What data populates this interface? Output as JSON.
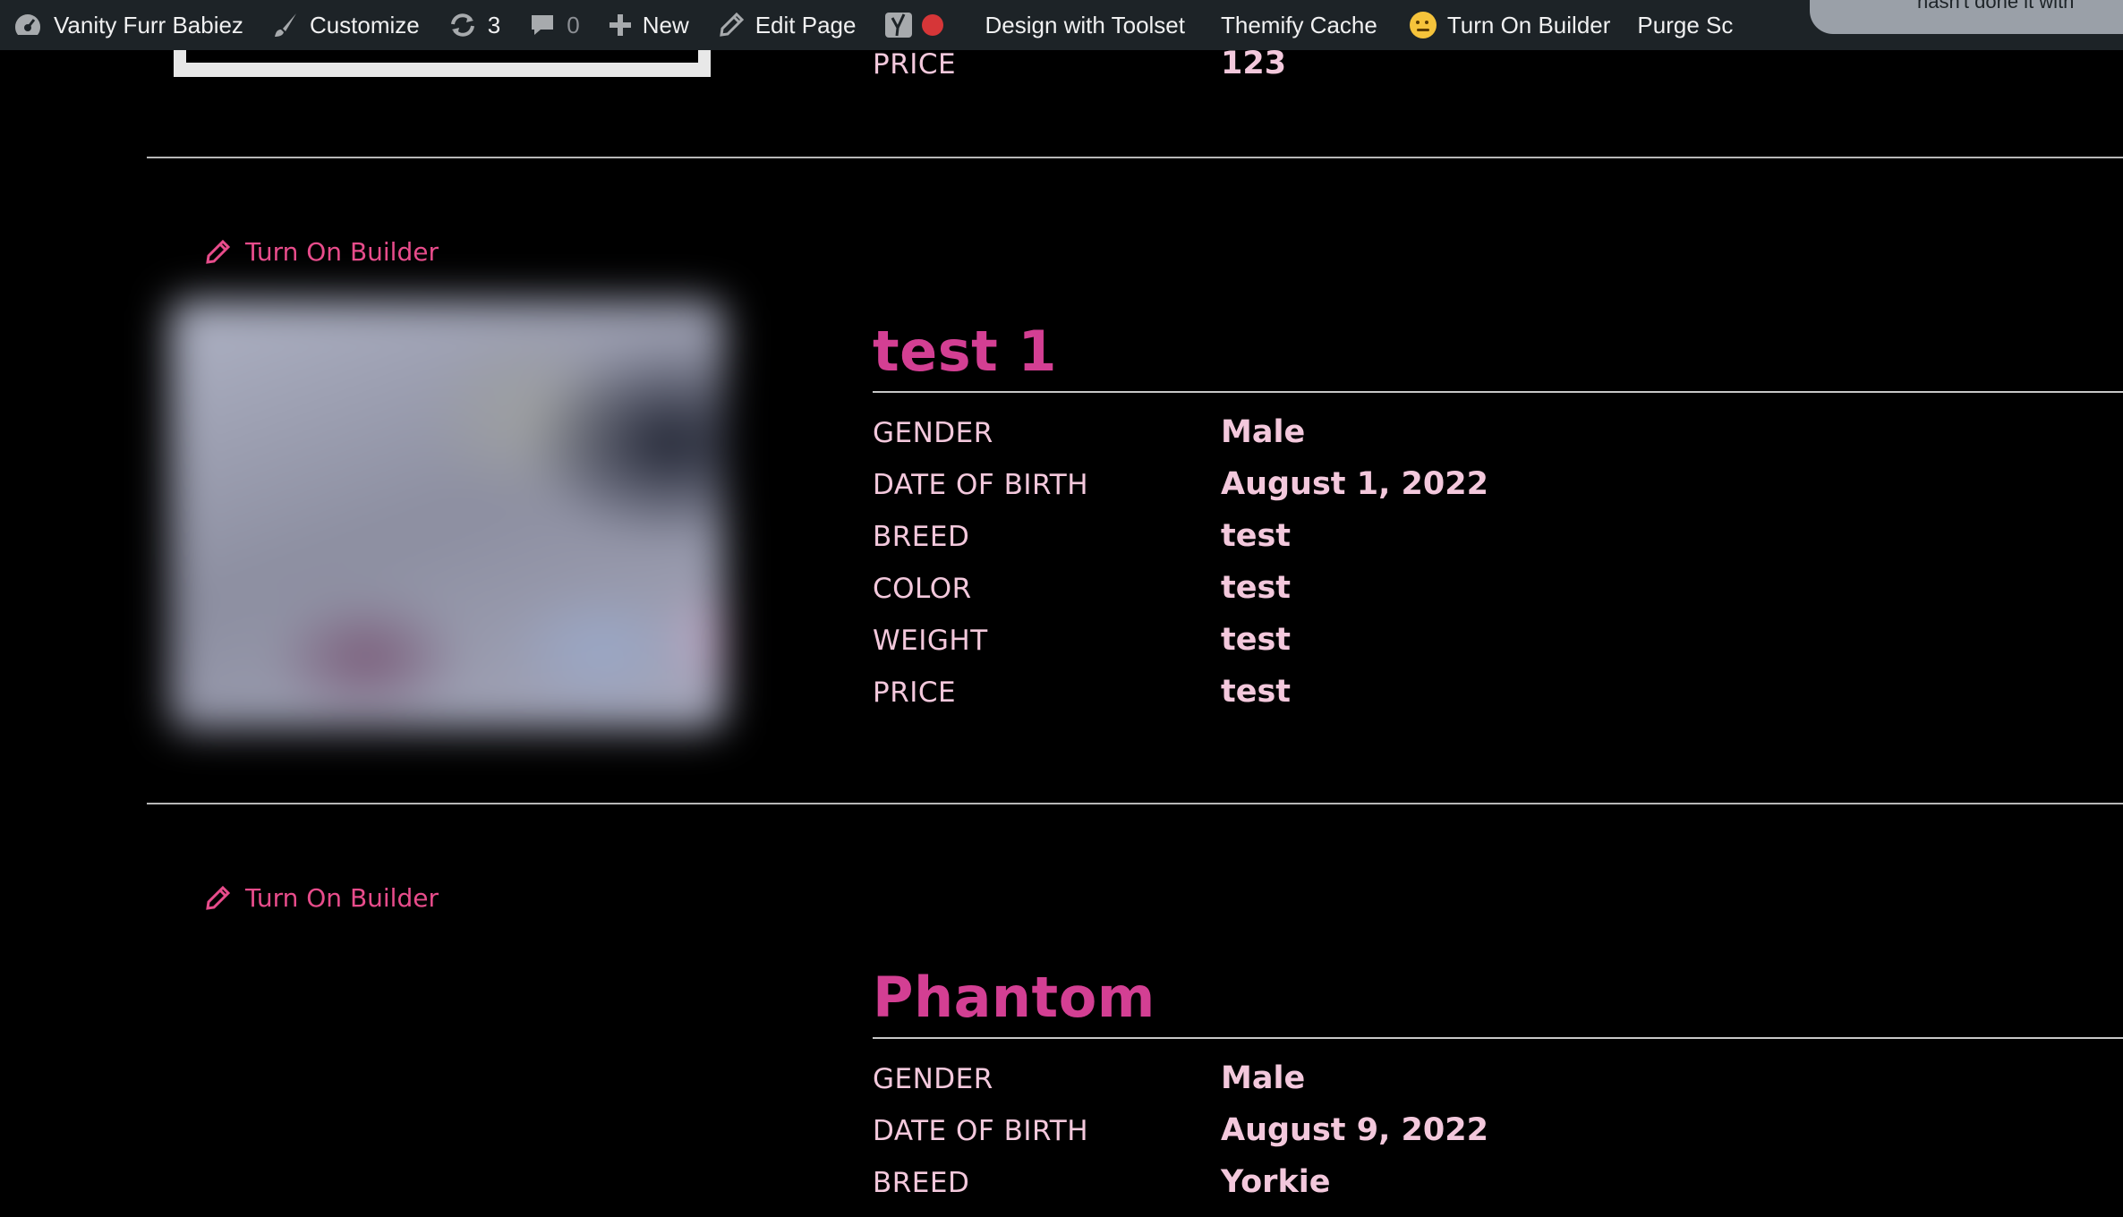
{
  "adminbar": {
    "site_name": "Vanity Furr Babiez",
    "customize": "Customize",
    "updates_count": "3",
    "comments_count": "0",
    "new": "New",
    "edit_page": "Edit Page",
    "design_toolset": "Design with Toolset",
    "themify_cache": "Themify Cache",
    "turn_on_builder": "Turn On Builder",
    "purge": "Purge Sc"
  },
  "notice_fragment": "hasn't done it with",
  "colors": {
    "accent": "#d33f93",
    "link": "#e84c8b",
    "text": "#f3c8dc",
    "adminbar": "#1d2327"
  },
  "entries": [
    {
      "fields": [
        {
          "label": "PRICE",
          "value": "123"
        }
      ]
    },
    {
      "builder_link": "Turn On Builder",
      "title": "test 1",
      "fields": [
        {
          "label": "GENDER",
          "value": "Male"
        },
        {
          "label": "DATE OF BIRTH",
          "value": "August 1, 2022"
        },
        {
          "label": "BREED",
          "value": "test"
        },
        {
          "label": "COLOR",
          "value": "test"
        },
        {
          "label": "WEIGHT",
          "value": "test"
        },
        {
          "label": "PRICE",
          "value": "test"
        }
      ]
    },
    {
      "builder_link": "Turn On Builder",
      "title": "Phantom",
      "fields": [
        {
          "label": "GENDER",
          "value": "Male"
        },
        {
          "label": "DATE OF BIRTH",
          "value": "August 9, 2022"
        },
        {
          "label": "BREED",
          "value": "Yorkie"
        }
      ]
    }
  ]
}
